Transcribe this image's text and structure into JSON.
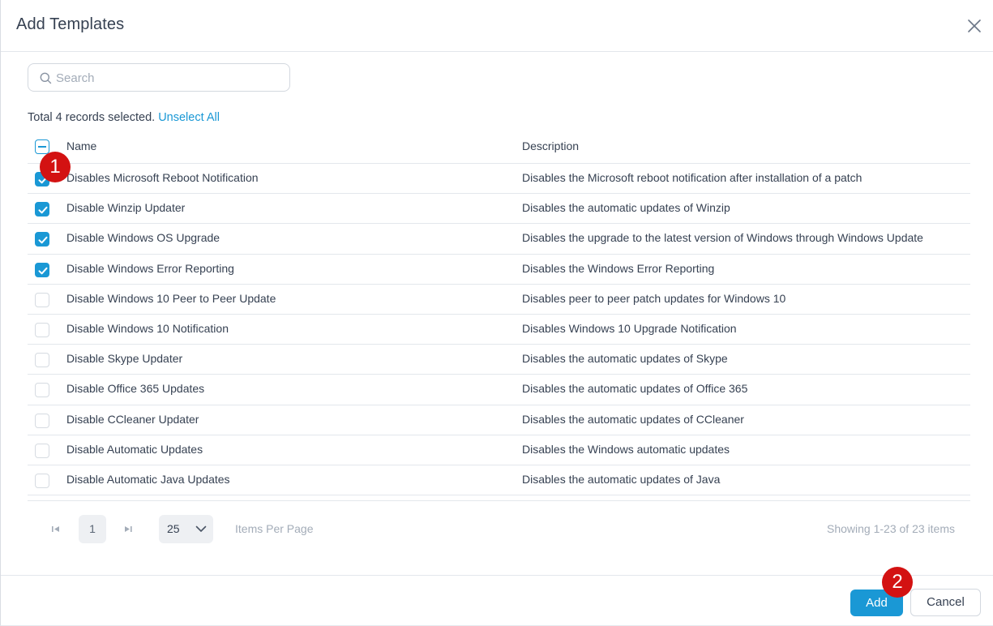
{
  "dialog": {
    "title": "Add Templates"
  },
  "search": {
    "placeholder": "Search"
  },
  "selection": {
    "summary": "Total 4 records selected.",
    "unselect_label": "Unselect All"
  },
  "table": {
    "columns": {
      "name": "Name",
      "description": "Description"
    },
    "rows": [
      {
        "name": "Disables Microsoft Reboot Notification",
        "description": "Disables the Microsoft reboot notification after installation of a patch",
        "checked": true
      },
      {
        "name": "Disable Winzip Updater",
        "description": "Disables the automatic updates of Winzip",
        "checked": true
      },
      {
        "name": "Disable Windows OS Upgrade",
        "description": "Disables the upgrade to the latest version of Windows through Windows Update",
        "checked": true
      },
      {
        "name": "Disable Windows Error Reporting",
        "description": "Disables the Windows Error Reporting",
        "checked": true
      },
      {
        "name": "Disable Windows 10 Peer to Peer Update",
        "description": "Disables peer to peer patch updates for Windows 10",
        "checked": false
      },
      {
        "name": "Disable Windows 10 Notification",
        "description": "Disables Windows 10 Upgrade Notification",
        "checked": false
      },
      {
        "name": "Disable Skype Updater",
        "description": "Disables the automatic updates of Skype",
        "checked": false
      },
      {
        "name": "Disable Office 365 Updates",
        "description": "Disables the automatic updates of Office 365",
        "checked": false
      },
      {
        "name": "Disable CCleaner Updater",
        "description": "Disables the automatic updates of CCleaner",
        "checked": false
      },
      {
        "name": "Disable Automatic Updates",
        "description": "Disables the Windows automatic updates",
        "checked": false
      },
      {
        "name": "Disable Automatic Java Updates",
        "description": "Disables the automatic updates of Java",
        "checked": false
      }
    ]
  },
  "pagination": {
    "current_page": "1",
    "page_size": "25",
    "items_per_page_label": "Items Per Page",
    "showing": "Showing 1-23 of 23 items"
  },
  "footer": {
    "add_label": "Add",
    "cancel_label": "Cancel"
  },
  "annotations": {
    "marker1": "1",
    "marker2": "2"
  },
  "colors": {
    "accent": "#1a98d5",
    "marker": "#d31212"
  }
}
